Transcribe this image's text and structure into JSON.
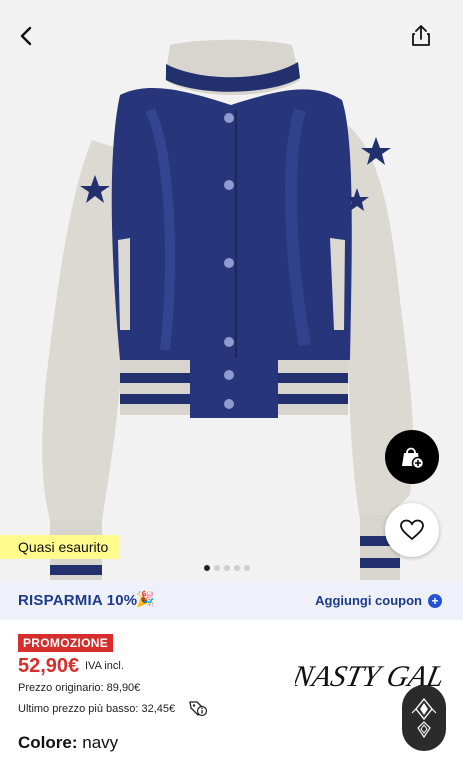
{
  "product": {
    "scarcity_label": "Quasi esaurito",
    "carousel": {
      "count": 5,
      "active": 0
    }
  },
  "savings": {
    "label": "RISPARMIA 10%",
    "party_icon": "🎉",
    "coupon_action": "Aggiungi coupon",
    "coupon_icon": "plus-circle-icon"
  },
  "pricing": {
    "promo_badge": "PROMOZIONE",
    "price": "52,90€",
    "vat_note": "IVA incl.",
    "original_price": "Prezzo originario: 89,90€",
    "lowest_price": "Ultimo prezzo più basso: 32,45€"
  },
  "color": {
    "label": "Colore:",
    "value": "navy"
  },
  "brand": {
    "name": "NASTY GAL"
  },
  "icons": {
    "back": "chevron-left-icon",
    "share": "share-icon",
    "bag": "add-to-bag-icon",
    "favorite": "heart-icon",
    "info": "tag-info-icon"
  },
  "colors": {
    "accent_blue": "#1e3a8a",
    "sale_red": "#d62d2d",
    "scarcity_yellow": "#fffb8c",
    "jacket_navy": "#22306e",
    "sleeve_grey": "#dcd8d2"
  }
}
